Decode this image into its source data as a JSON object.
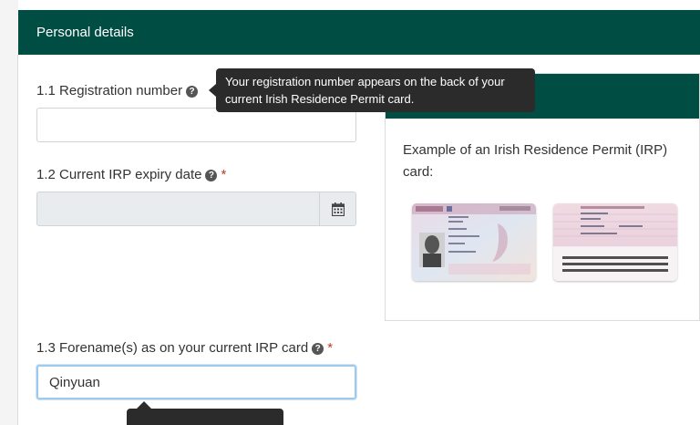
{
  "section": {
    "title": "Personal details"
  },
  "fields": {
    "registration": {
      "label": "1.1 Registration number",
      "value": ""
    },
    "expiry": {
      "label": "1.2 Current IRP expiry date",
      "required_mark": "*",
      "value": ""
    },
    "forename": {
      "label": "1.3 Forename(s) as on your current IRP card",
      "required_mark": "*",
      "value": "Qinyuan"
    }
  },
  "tooltip": {
    "text_line1": "Your registration number appears on the back of your",
    "text_line2": "current Irish Residence Permit card."
  },
  "example": {
    "text": "Example of an Irish Residence Permit (IRP) card:"
  },
  "icons": {
    "help": "question-circle-icon",
    "calendar": "calendar-icon"
  },
  "colors": {
    "header_bg": "#004d44",
    "required": "#c0392b",
    "tooltip_bg": "#2b2b2b",
    "focus_border": "#9ecaed"
  }
}
